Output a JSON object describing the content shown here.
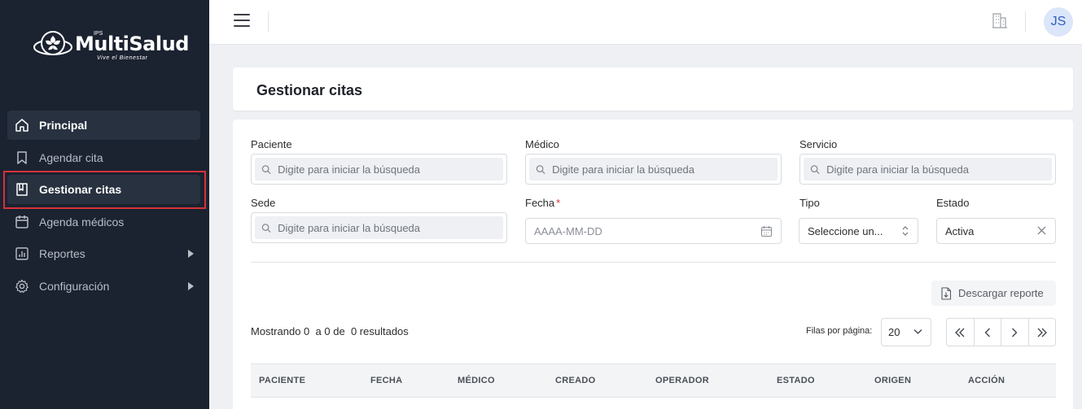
{
  "brand": {
    "name": "MultiSalud",
    "prefix": "IPS",
    "tagline": "Vive el Bienestar"
  },
  "sidebar": {
    "items": [
      {
        "label": "Principal",
        "icon": "home-icon"
      },
      {
        "label": "Agendar cita",
        "icon": "bookmark-icon"
      },
      {
        "label": "Gestionar citas",
        "icon": "book-icon"
      },
      {
        "label": "Agenda médicos",
        "icon": "calendar-icon"
      },
      {
        "label": "Reportes",
        "icon": "chart-icon"
      },
      {
        "label": "Configuración",
        "icon": "gear-icon"
      }
    ]
  },
  "topbar": {
    "avatar_initials": "JS"
  },
  "page": {
    "title": "Gestionar citas"
  },
  "filters": {
    "paciente": {
      "label": "Paciente",
      "placeholder": "Digite para iniciar la búsqueda"
    },
    "medico": {
      "label": "Médico",
      "placeholder": "Digite para iniciar la búsqueda"
    },
    "servicio": {
      "label": "Servicio",
      "placeholder": "Digite para iniciar la búsqueda"
    },
    "sede": {
      "label": "Sede",
      "placeholder": "Digite para iniciar la búsqueda"
    },
    "fecha": {
      "label": "Fecha",
      "required_mark": "*",
      "placeholder": "AAAA-MM-DD"
    },
    "tipo": {
      "label": "Tipo",
      "value": "Seleccione un..."
    },
    "estado": {
      "label": "Estado",
      "value": "Activa"
    }
  },
  "actions": {
    "download_label": "Descargar reporte"
  },
  "results": {
    "prefix": "Mostrando",
    "from": "0",
    "to_word": "a",
    "to": "0",
    "of_word": "de",
    "total": "0",
    "suffix": "resultados"
  },
  "pagination": {
    "rows_label": "Filas por página:",
    "rows_value": "20"
  },
  "table": {
    "columns": [
      "PACIENTE",
      "FECHA",
      "MÉDICO",
      "CREADO",
      "OPERADOR",
      "ESTADO",
      "ORIGEN",
      "ACCIÓN"
    ]
  },
  "colors": {
    "sidebar_bg": "#1b2230",
    "accent_red": "#d6323a",
    "avatar_bg": "#dbe6fb"
  }
}
